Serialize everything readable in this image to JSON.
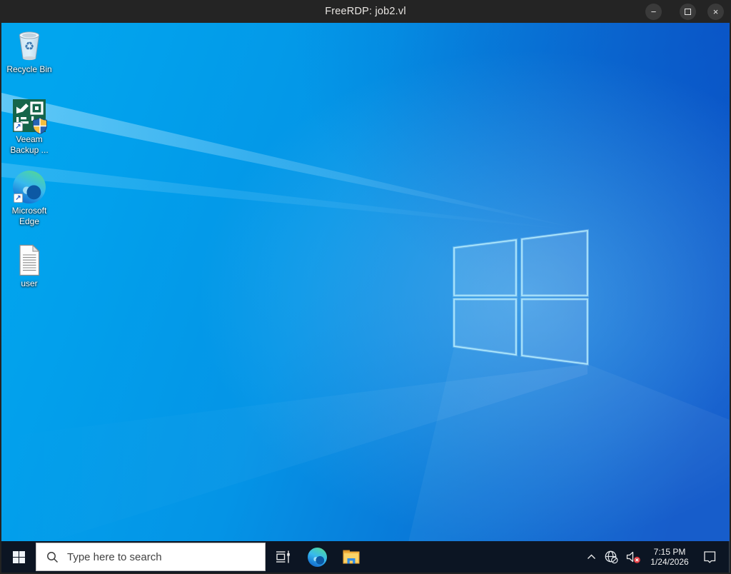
{
  "window": {
    "title": "FreeRDP: job2.vl"
  },
  "icons": {
    "minimize_glyph": "−",
    "close_glyph": "×",
    "shortcut_arrow_glyph": "↗",
    "recycle_symbol": "♻"
  },
  "desktop": {
    "icons": [
      {
        "name": "recycle-bin",
        "line1": "Recycle Bin",
        "line2": ""
      },
      {
        "name": "veeam-backup",
        "line1": "Veeam",
        "line2": "Backup ..."
      },
      {
        "name": "microsoft-edge",
        "line1": "Microsoft",
        "line2": "Edge"
      },
      {
        "name": "user-file",
        "line1": "user",
        "line2": ""
      }
    ]
  },
  "taskbar": {
    "search": {
      "placeholder": "Type here to search"
    },
    "clock": {
      "time": "7:15 PM",
      "date": "1/24/2026"
    }
  },
  "colors": {
    "titlebar_bg": "#242424",
    "taskbar_bg": "#0c1523",
    "wallpaper_bright": "#00a6ef",
    "wallpaper_deep": "#0b51c7",
    "search_bg": "#ffffff",
    "veeam_green": "#15654a",
    "folder_yellow": "#f0b03c",
    "mute_badge_red": "#e0393e"
  }
}
